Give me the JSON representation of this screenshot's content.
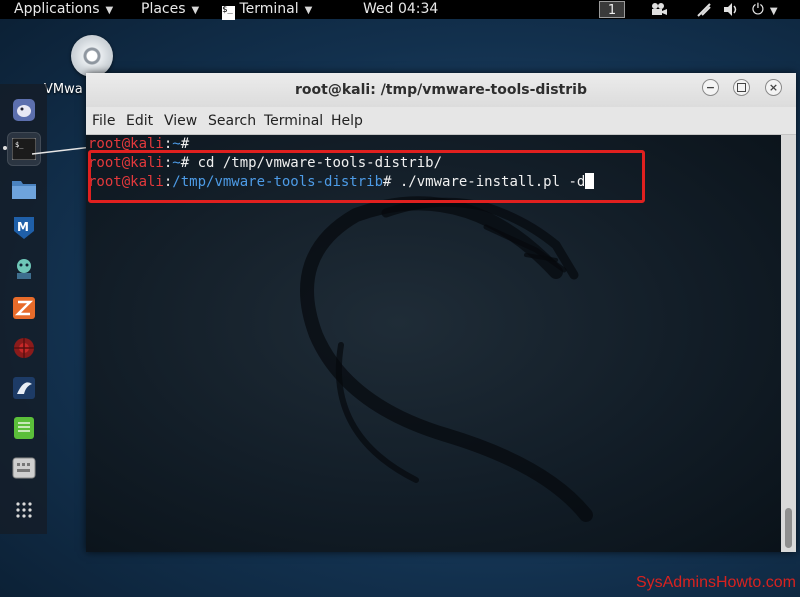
{
  "topbar": {
    "applications": "Applications",
    "places": "Places",
    "terminal": "Terminal",
    "clock": "Wed 04:34",
    "workspace": "1",
    "icons": [
      "camera-icon",
      "wifi-icon",
      "volume-icon",
      "power-icon"
    ]
  },
  "desktop": {
    "icon_label": "VMwa",
    "icon": "disc-icon"
  },
  "dock": {
    "items": [
      "pidgin-icon",
      "terminal-icon",
      "files-icon",
      "metasploit-icon",
      "armitage-icon",
      "burp-icon",
      "maltego-icon",
      "beef-icon",
      "notes-icon",
      "keyboard-icon",
      "apps-grid-icon"
    ]
  },
  "window": {
    "title": "root@kali: /tmp/vmware-tools-distrib",
    "menu": [
      "File",
      "Edit",
      "View",
      "Search",
      "Terminal",
      "Help"
    ]
  },
  "terminal": {
    "lines": [
      {
        "user": "root@kali",
        "sep": ":",
        "path": "~",
        "prompt": "# ",
        "cmd": ""
      },
      {
        "user": "root@kali",
        "sep": ":",
        "path": "~",
        "prompt": "# ",
        "cmd": "cd /tmp/vmware-tools-distrib/"
      },
      {
        "user": "root@kali",
        "sep": ":",
        "path": "/tmp/vmware-tools-distrib",
        "prompt": "# ",
        "cmd": "./vmware-install.pl -d"
      }
    ]
  },
  "colors": {
    "user": "#e3393c",
    "path": "#4d9be6",
    "highlight": "#e0201f"
  },
  "watermark": "SysAdminsHowto.com"
}
